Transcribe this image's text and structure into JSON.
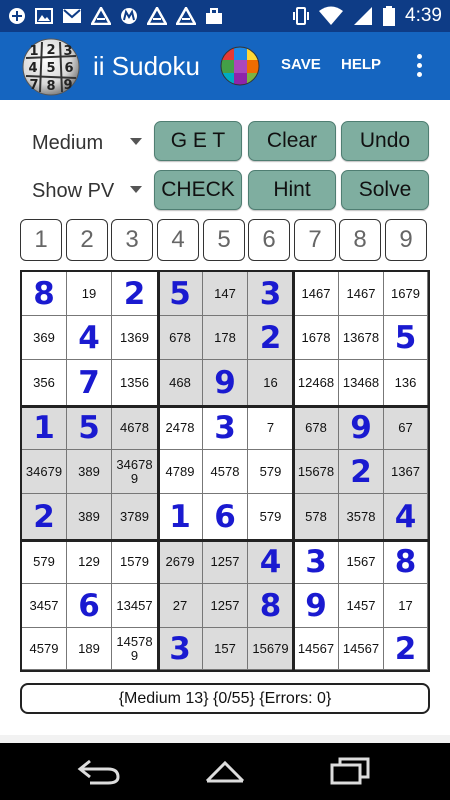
{
  "status_bar": {
    "time": "4:39",
    "notification_icons": [
      "plus-icon",
      "image-icon",
      "gmail-icon",
      "app-a-icon",
      "motorola-icon",
      "app-a-icon",
      "app-a-icon",
      "briefcase-icon"
    ],
    "system_icons": [
      "vibrate-icon",
      "wifi-icon",
      "signal-icon",
      "battery-icon"
    ]
  },
  "app_bar": {
    "title": "ii Sudoku",
    "save_label": "SAVE",
    "help_label": "HELP",
    "logo_digits": [
      "1",
      "2",
      "3",
      "4",
      "5",
      "6",
      "7",
      "8",
      "9"
    ]
  },
  "controls": {
    "difficulty": "Medium",
    "mode": "Show PV",
    "buttons": [
      "G E T",
      "Clear",
      "Undo",
      "CHECK",
      "Hint",
      "Solve"
    ]
  },
  "number_buttons": [
    "1",
    "2",
    "3",
    "4",
    "5",
    "6",
    "7",
    "8",
    "9"
  ],
  "grid": {
    "rows": [
      [
        {
          "v": "8",
          "g": true
        },
        {
          "v": "19",
          "g": false
        },
        {
          "v": "2",
          "g": true
        },
        {
          "v": "5",
          "g": true
        },
        {
          "v": "147",
          "g": false
        },
        {
          "v": "3",
          "g": true
        },
        {
          "v": "1467",
          "g": false
        },
        {
          "v": "1467",
          "g": false
        },
        {
          "v": "1679",
          "g": false
        }
      ],
      [
        {
          "v": "369",
          "g": false
        },
        {
          "v": "4",
          "g": true
        },
        {
          "v": "1369",
          "g": false
        },
        {
          "v": "678",
          "g": false
        },
        {
          "v": "178",
          "g": false
        },
        {
          "v": "2",
          "g": true
        },
        {
          "v": "1678",
          "g": false
        },
        {
          "v": "13678",
          "g": false
        },
        {
          "v": "5",
          "g": true
        }
      ],
      [
        {
          "v": "356",
          "g": false
        },
        {
          "v": "7",
          "g": true
        },
        {
          "v": "1356",
          "g": false
        },
        {
          "v": "468",
          "g": false
        },
        {
          "v": "9",
          "g": true
        },
        {
          "v": "16",
          "g": false
        },
        {
          "v": "12468",
          "g": false
        },
        {
          "v": "13468",
          "g": false
        },
        {
          "v": "136",
          "g": false
        }
      ],
      [
        {
          "v": "1",
          "g": true
        },
        {
          "v": "5",
          "g": true
        },
        {
          "v": "4678",
          "g": false
        },
        {
          "v": "2478",
          "g": false
        },
        {
          "v": "3",
          "g": true
        },
        {
          "v": "7",
          "g": false
        },
        {
          "v": "678",
          "g": false
        },
        {
          "v": "9",
          "g": true
        },
        {
          "v": "67",
          "g": false
        }
      ],
      [
        {
          "v": "34679",
          "g": false
        },
        {
          "v": "389",
          "g": false
        },
        {
          "v": "346789",
          "g": false
        },
        {
          "v": "4789",
          "g": false
        },
        {
          "v": "4578",
          "g": false
        },
        {
          "v": "579",
          "g": false
        },
        {
          "v": "15678",
          "g": false
        },
        {
          "v": "2",
          "g": true
        },
        {
          "v": "1367",
          "g": false
        }
      ],
      [
        {
          "v": "2",
          "g": true
        },
        {
          "v": "389",
          "g": false
        },
        {
          "v": "3789",
          "g": false
        },
        {
          "v": "1",
          "g": true
        },
        {
          "v": "6",
          "g": true
        },
        {
          "v": "579",
          "g": false
        },
        {
          "v": "578",
          "g": false
        },
        {
          "v": "3578",
          "g": false
        },
        {
          "v": "4",
          "g": true
        }
      ],
      [
        {
          "v": "579",
          "g": false
        },
        {
          "v": "129",
          "g": false
        },
        {
          "v": "1579",
          "g": false
        },
        {
          "v": "2679",
          "g": false
        },
        {
          "v": "1257",
          "g": false
        },
        {
          "v": "4",
          "g": true
        },
        {
          "v": "3",
          "g": true
        },
        {
          "v": "1567",
          "g": false
        },
        {
          "v": "8",
          "g": true
        }
      ],
      [
        {
          "v": "3457",
          "g": false
        },
        {
          "v": "6",
          "g": true
        },
        {
          "v": "13457",
          "g": false
        },
        {
          "v": "27",
          "g": false
        },
        {
          "v": "1257",
          "g": false
        },
        {
          "v": "8",
          "g": true
        },
        {
          "v": "9",
          "g": true
        },
        {
          "v": "1457",
          "g": false
        },
        {
          "v": "17",
          "g": false
        }
      ],
      [
        {
          "v": "4579",
          "g": false
        },
        {
          "v": "189",
          "g": false
        },
        {
          "v": "145789",
          "g": false
        },
        {
          "v": "3",
          "g": true
        },
        {
          "v": "157",
          "g": false
        },
        {
          "v": "15679",
          "g": false
        },
        {
          "v": "14567",
          "g": false
        },
        {
          "v": "14567",
          "g": false
        },
        {
          "v": "2",
          "g": true
        }
      ]
    ]
  },
  "status_text": "{Medium 13} {0/55} {Errors: 0}",
  "nav": [
    "back-icon",
    "home-icon",
    "recents-icon"
  ]
}
